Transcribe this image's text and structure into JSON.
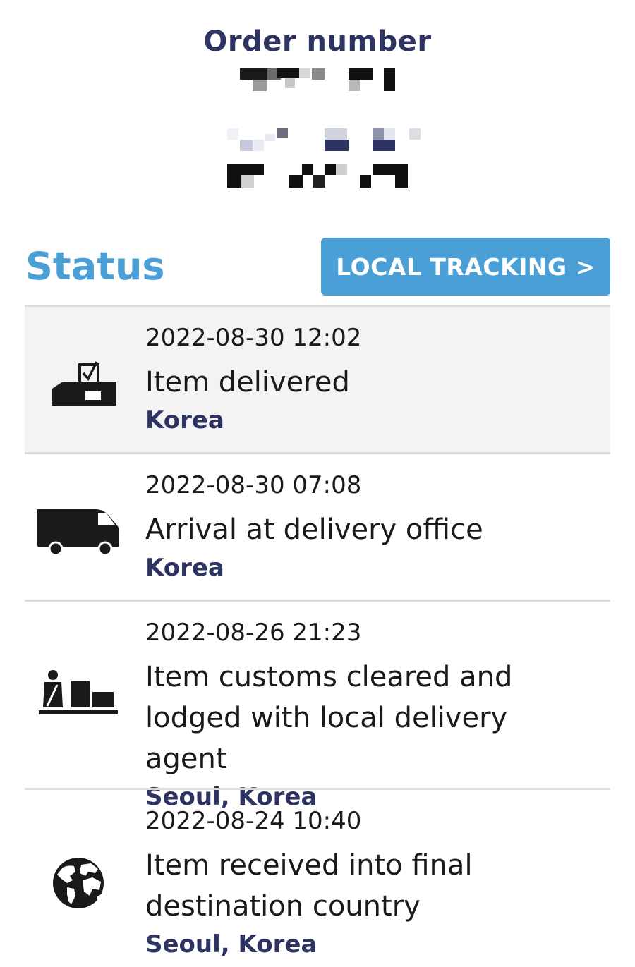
{
  "order": {
    "title": "Order number"
  },
  "status": {
    "title": "Status",
    "local_tracking_label": "LOCAL TRACKING >"
  },
  "colors": {
    "accent": "#4a9fd6",
    "navy": "#2d3461",
    "highlight_row": "#f3f3f3",
    "divider": "#dcdcdc"
  },
  "events": [
    {
      "icon": "mailbox-delivered-icon",
      "time": "2022-08-30 12:02",
      "description": "Item delivered",
      "location": "Korea"
    },
    {
      "icon": "delivery-van-icon",
      "time": "2022-08-30 07:08",
      "description": "Arrival at delivery office",
      "location": "Korea"
    },
    {
      "icon": "customs-agent-icon",
      "time": "2022-08-26 21:23",
      "description": "Item customs cleared and lodged with local delivery agent",
      "location": "Seoul, Korea"
    },
    {
      "icon": "globe-icon",
      "time": "2022-08-24 10:40",
      "description": "Item received into final destination country",
      "location": "Seoul, Korea"
    }
  ]
}
